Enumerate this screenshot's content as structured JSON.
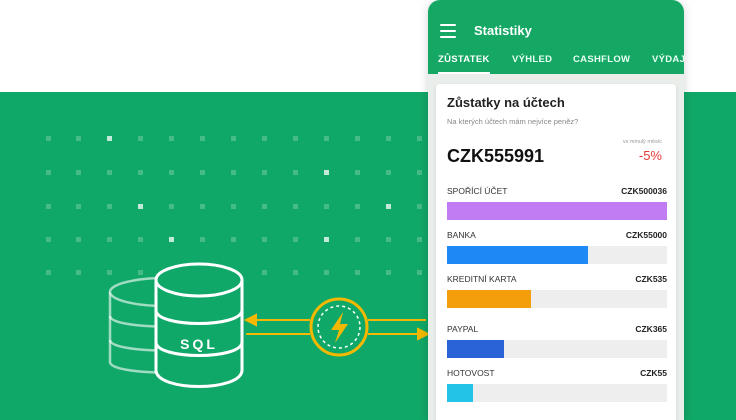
{
  "app": {
    "title": "Statistiky",
    "tabs": [
      {
        "label": "ZŮSTATEK",
        "active": true
      },
      {
        "label": "VÝHLED",
        "active": false
      },
      {
        "label": "CASHFLOW",
        "active": false
      },
      {
        "label": "VÝDAJ",
        "active": false
      }
    ]
  },
  "card": {
    "title": "Zůstatky na účtech",
    "subtitle": "Na kterých účtech mám nejvíce peněz?",
    "total": "CZK555991",
    "vs_label": "vs minulý měsíc",
    "vs_value": "-5%",
    "accounts": [
      {
        "name": "SPOŘÍCÍ ÚČET",
        "value": "CZK500036",
        "fraction": 1.0,
        "color": "#c17cf3"
      },
      {
        "name": "BANKA",
        "value": "CZK55000",
        "fraction": 0.64,
        "color": "#1e88f5"
      },
      {
        "name": "KREDITNÍ KARTA",
        "value": "CZK535",
        "fraction": 0.38,
        "color": "#f59e0b"
      },
      {
        "name": "PAYPAL",
        "value": "CZK365",
        "fraction": 0.26,
        "color": "#2a63d8"
      },
      {
        "name": "HOTOVOST",
        "value": "CZK55",
        "fraction": 0.12,
        "color": "#22c3e6"
      }
    ]
  },
  "illustration": {
    "db_label": "SQL",
    "icons": [
      "database-icon",
      "lightning-icon"
    ],
    "colors": {
      "band": "#10a868",
      "accent": "#f5b800",
      "appbar": "#14a864"
    }
  }
}
